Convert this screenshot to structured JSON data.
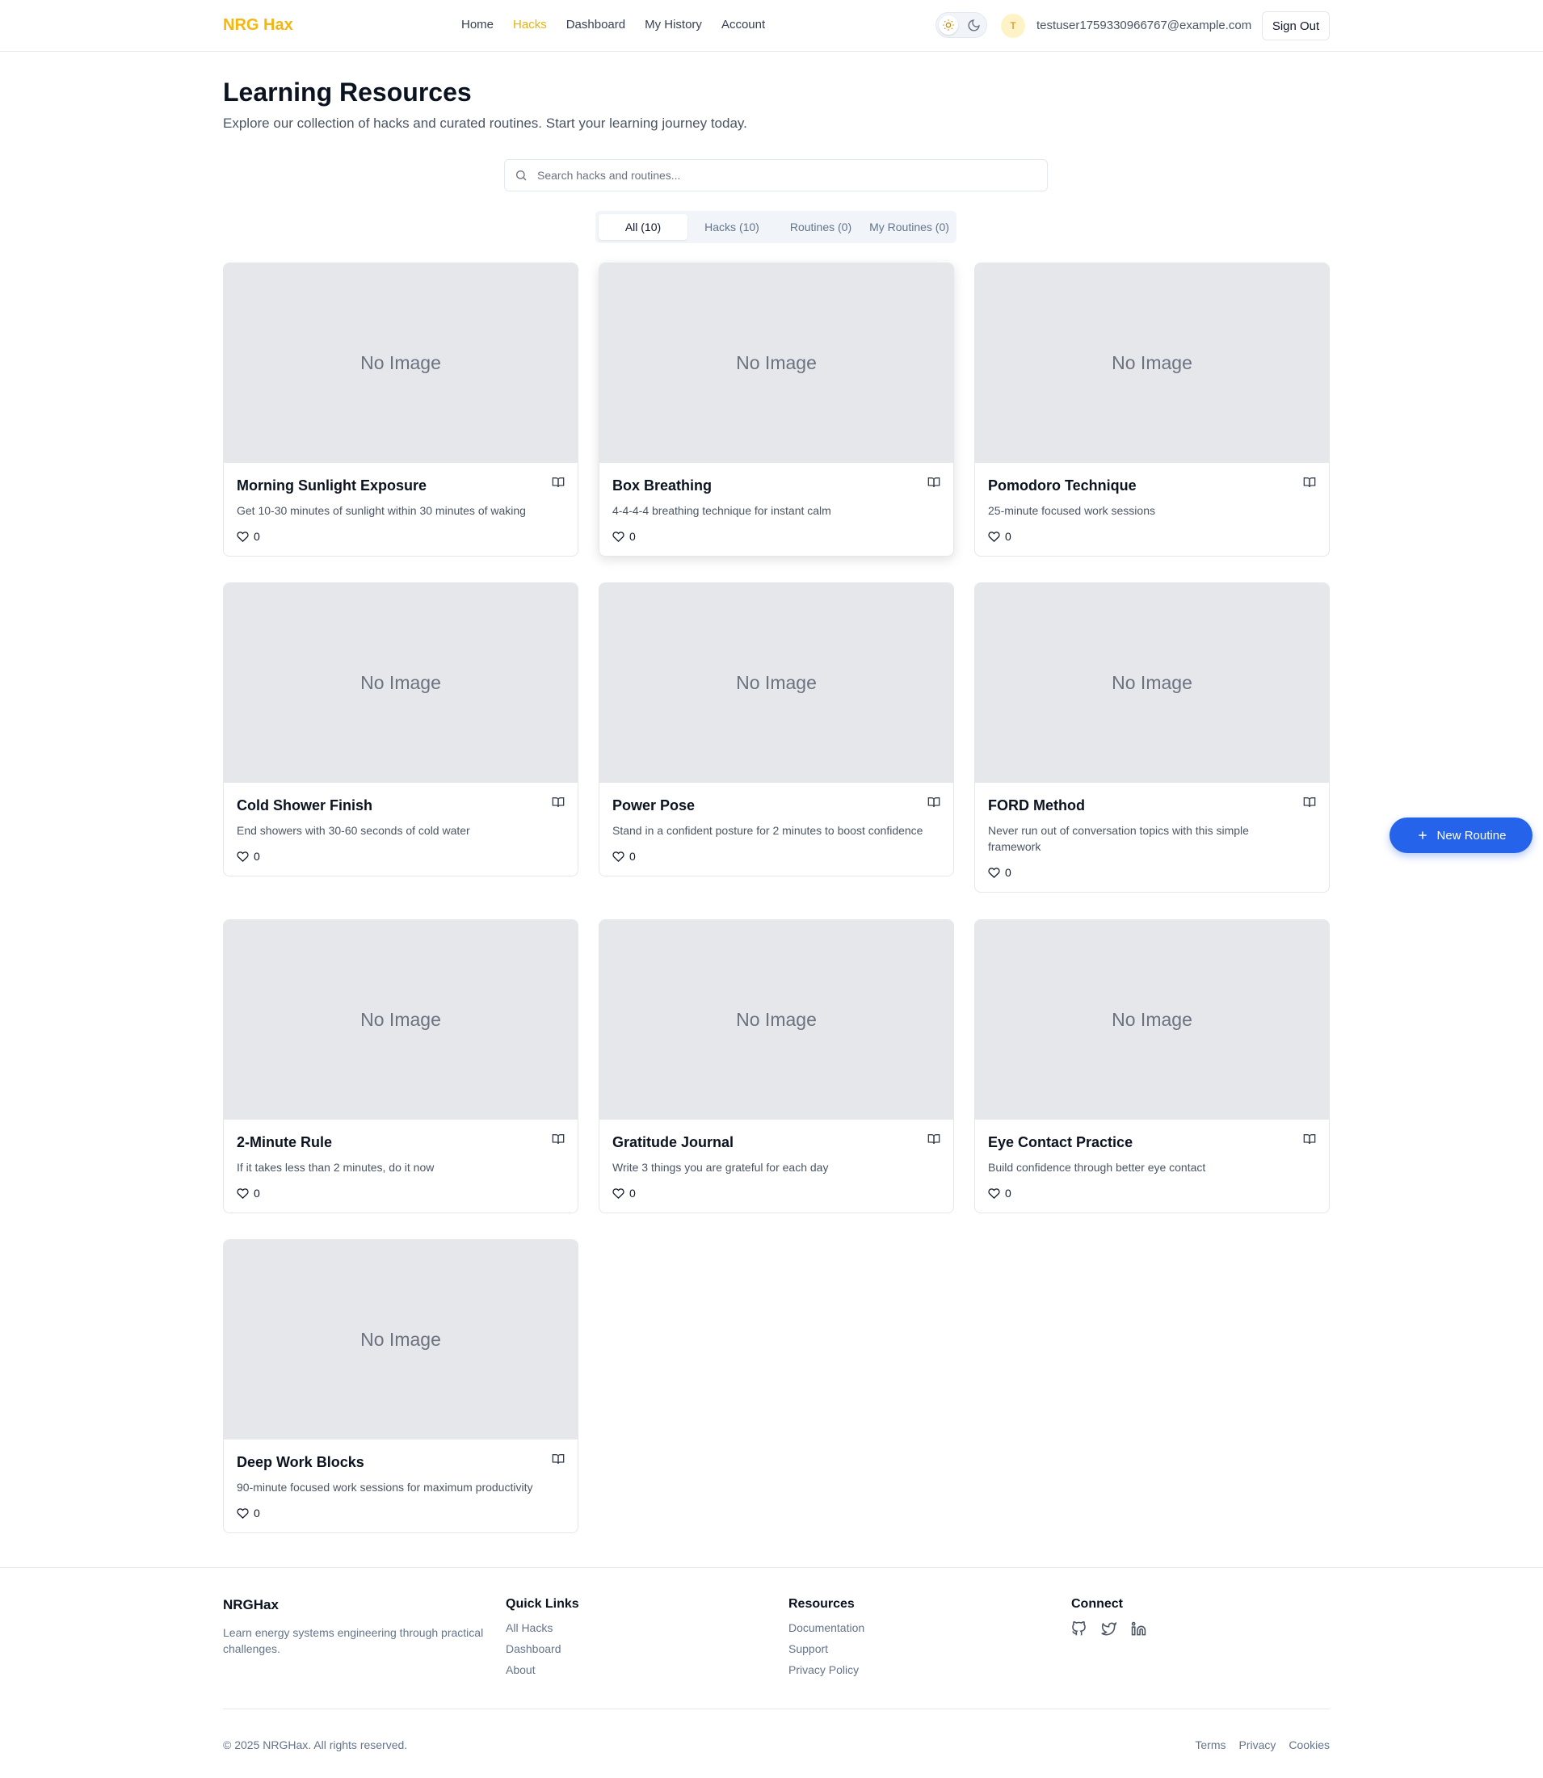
{
  "header": {
    "logo": "NRG Hax",
    "nav": [
      "Home",
      "Hacks",
      "Dashboard",
      "My History",
      "Account"
    ],
    "active_nav": "Hacks",
    "avatar_initial": "T",
    "user_email": "testuser1759330966767@example.com",
    "sign_out": "Sign Out"
  },
  "page": {
    "title": "Learning Resources",
    "subtitle": "Explore our collection of hacks and curated routines. Start your learning journey today.",
    "search_placeholder": "Search hacks and routines...",
    "tabs": [
      "All (10)",
      "Hacks (10)",
      "Routines (0)",
      "My Routines (0)"
    ],
    "active_tab": "All (10)"
  },
  "image_placeholder": "No Image",
  "cards": [
    {
      "title": "Morning Sunlight Exposure",
      "desc": "Get 10-30 minutes of sunlight within 30 minutes of waking",
      "likes": "0"
    },
    {
      "title": "Box Breathing",
      "desc": "4-4-4-4 breathing technique for instant calm",
      "likes": "0"
    },
    {
      "title": "Pomodoro Technique",
      "desc": "25-minute focused work sessions",
      "likes": "0"
    },
    {
      "title": "Cold Shower Finish",
      "desc": "End showers with 30-60 seconds of cold water",
      "likes": "0"
    },
    {
      "title": "Power Pose",
      "desc": "Stand in a confident posture for 2 minutes to boost confidence",
      "likes": "0"
    },
    {
      "title": "FORD Method",
      "desc": "Never run out of conversation topics with this simple framework",
      "likes": "0"
    },
    {
      "title": "2-Minute Rule",
      "desc": "If it takes less than 2 minutes, do it now",
      "likes": "0"
    },
    {
      "title": "Gratitude Journal",
      "desc": "Write 3 things you are grateful for each day",
      "likes": "0"
    },
    {
      "title": "Eye Contact Practice",
      "desc": "Build confidence through better eye contact",
      "likes": "0"
    },
    {
      "title": "Deep Work Blocks",
      "desc": "90-minute focused work sessions for maximum productivity",
      "likes": "0"
    }
  ],
  "fab": "New Routine",
  "footer": {
    "brand": "NRGHax",
    "tagline": "Learn energy systems engineering through practical challenges.",
    "quick_links_title": "Quick Links",
    "quick_links": [
      "All Hacks",
      "Dashboard",
      "About"
    ],
    "resources_title": "Resources",
    "resources": [
      "Documentation",
      "Support",
      "Privacy Policy"
    ],
    "connect_title": "Connect",
    "social_icons": [
      "github-icon",
      "twitter-icon",
      "linkedin-icon"
    ],
    "copyright": "© 2025 NRGHax. All rights reserved.",
    "legal": [
      "Terms",
      "Privacy",
      "Cookies"
    ]
  },
  "colors": {
    "brand": "#f5b60f",
    "accent_blue": "#2563eb",
    "placeholder_bg": "#e5e7eb"
  }
}
